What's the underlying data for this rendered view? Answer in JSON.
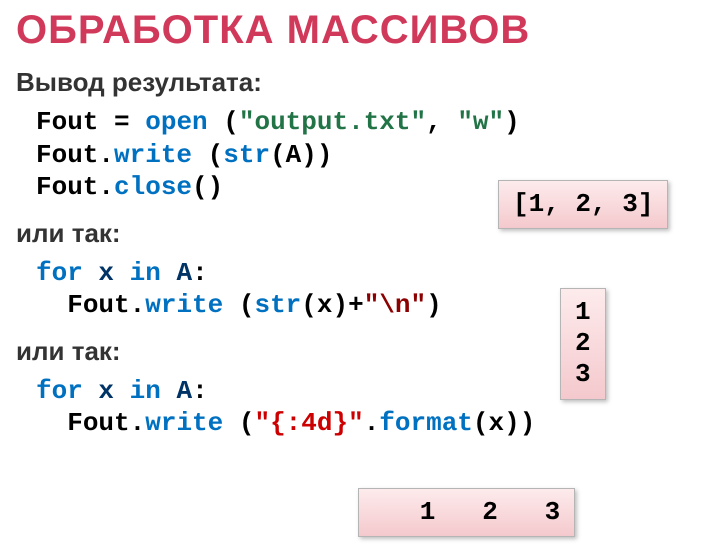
{
  "title": "ОБРАБОТКА МАССИВОВ",
  "sections": {
    "result_label": "Вывод результата:",
    "alt1_label": "или так:",
    "alt2_label": "или так:"
  },
  "code": {
    "l1_a": "Fout",
    "l1_eq": " = ",
    "l1_open": "open",
    "l1_b": " (",
    "l1_s1": "\"output.txt\"",
    "l1_c": ", ",
    "l1_s2": "\"w\"",
    "l1_d": ")",
    "l2_a": "Fout.",
    "l2_write": "write",
    "l2_b": " (",
    "l2_str": "str",
    "l2_c": "(A))",
    "l3_a": "Fout.",
    "l3_close": "close",
    "l3_b": "()",
    "l4_for": "for",
    "l4_sp1": " ",
    "l4_x": "x",
    "l4_sp2": " ",
    "l4_in": "in",
    "l4_sp3": " ",
    "l4_A": "A",
    "l4_colon": ":",
    "l5_ind": "  ",
    "l5_a": "Fout.",
    "l5_write": "write",
    "l5_b": " (",
    "l5_str": "str",
    "l5_c": "(x)+",
    "l5_nl": "\"\\n\"",
    "l5_d": ")",
    "l6_for": "for",
    "l6_sp1": " ",
    "l6_x": "x",
    "l6_sp2": " ",
    "l6_in": "in",
    "l6_sp3": " ",
    "l6_A": "A",
    "l6_colon": ":",
    "l7_ind": "  ",
    "l7_a": "Fout.",
    "l7_write": "write",
    "l7_b": " (",
    "l7_fmt": "\"{:4d}\"",
    "l7_dot": ".",
    "l7_format": "format",
    "l7_c": "(x))"
  },
  "outputs": {
    "o1": "[1, 2, 3]",
    "o2": "1\n2\n3",
    "o3": "   1   2   3"
  }
}
